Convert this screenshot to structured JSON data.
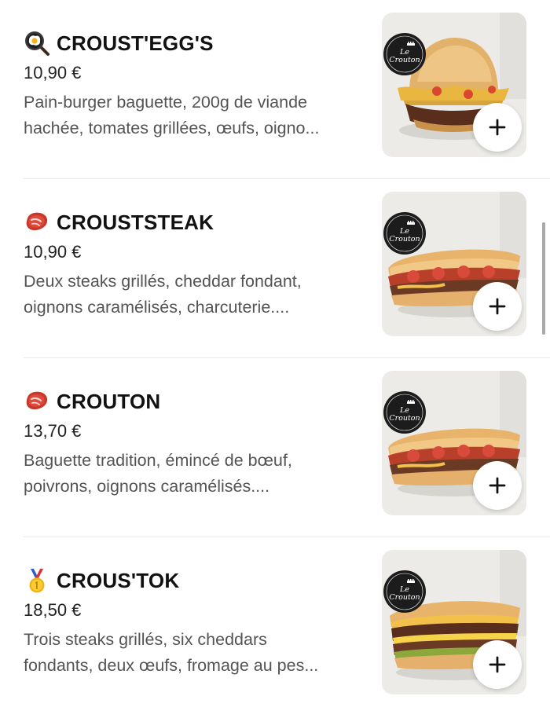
{
  "menu": {
    "items": [
      {
        "emoji": "fried-egg-pan-icon",
        "name": "CROUST'EGG'S",
        "price": "10,90 €",
        "desc_line1": "Pain-burger baguette, 200g de viande",
        "desc_line2": "hachée, tomates grillées, œufs, oigno...",
        "image_label": "Le Crouton",
        "add_label": "+"
      },
      {
        "emoji": "steak-icon",
        "name": "CROUSTSTEAK",
        "price": "10,90 €",
        "desc_line1": "Deux steaks grillés, cheddar fondant,",
        "desc_line2": "oignons caramélisés, charcuterie....",
        "image_label": "Le Crouton",
        "add_label": "+"
      },
      {
        "emoji": "steak-icon",
        "name": "CROUTON",
        "price": "13,70 €",
        "desc_line1": "Baguette tradition, émincé de bœuf,",
        "desc_line2": "poivrons, oignons caramélisés....",
        "image_label": "Le Crouton",
        "add_label": "+"
      },
      {
        "emoji": "gold-medal-icon",
        "name": "CROUS'TOK",
        "price": "18,50 €",
        "desc_line1": "Trois steaks grillés, six cheddars",
        "desc_line2": "fondants, deux œufs, fromage au pes...",
        "image_label": "Le Crouton",
        "add_label": "+"
      }
    ]
  },
  "colors": {
    "text": "#111111",
    "description": "#545454",
    "divider": "#e8e8e8",
    "image_background": "#ecebe7",
    "logo_background": "#1c1c1c"
  }
}
